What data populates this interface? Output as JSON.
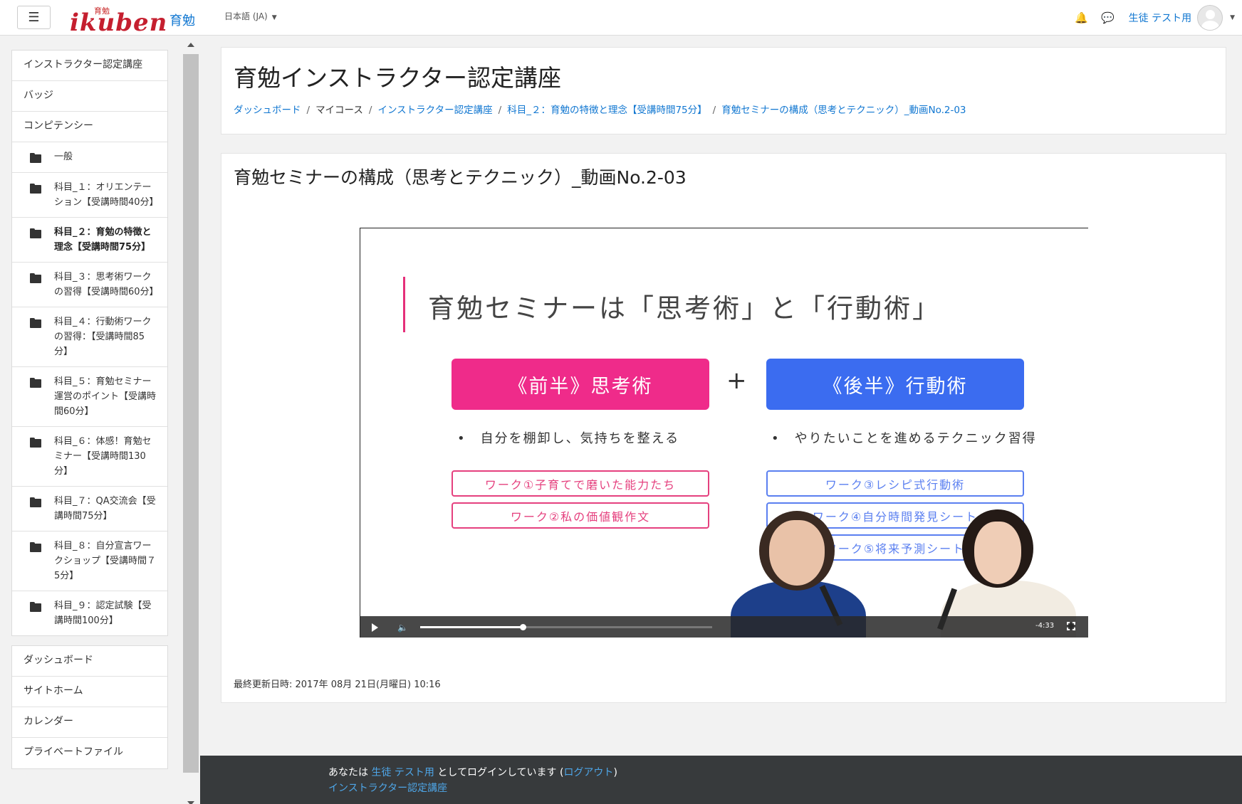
{
  "navbar": {
    "logo_small": "育勉",
    "logo_main": "ikuben",
    "site_name": "育勉",
    "language": "日本語 (JA)",
    "user_name": "生徒 テスト用"
  },
  "sidebar": {
    "top_items": [
      {
        "label": "インストラクター認定講座"
      },
      {
        "label": "バッジ"
      },
      {
        "label": "コンピテンシー"
      }
    ],
    "sections": [
      {
        "label": "一般"
      },
      {
        "label": "科目_１：オリエンテーション【受講時間40分】"
      },
      {
        "label": "科目_２：育勉の特徴と理念【受講時間75分】"
      },
      {
        "label": "科目_３：思考術ワークの習得【受講時間60分】"
      },
      {
        "label": "科目_４：行動術ワークの習得：【受講時間85分】"
      },
      {
        "label": "科目_５：育勉セミナー運営のポイント【受講時間60分】"
      },
      {
        "label": "科目_６：体感！育勉セミナー【受講時間130分】"
      },
      {
        "label": "科目_７：QA交流会【受講時間75分】"
      },
      {
        "label": "科目_８：自分宣言ワークショップ【受講時間７5分】"
      },
      {
        "label": "科目_９：認定試験【受講時間100分】"
      }
    ],
    "nav_items": [
      {
        "label": "ダッシュボード"
      },
      {
        "label": "サイトホーム"
      },
      {
        "label": "カレンダー"
      },
      {
        "label": "プライベートファイル"
      }
    ]
  },
  "header": {
    "title": "育勉インストラクター認定講座",
    "breadcrumb": [
      "ダッシュボード",
      "マイコース",
      "インストラクター認定講座",
      "科目_２：育勉の特徴と理念【受講時間75分】",
      "育勉セミナーの構成（思考とテクニック）_動画No.2-03"
    ]
  },
  "activity": {
    "title": "育勉セミナーの構成（思考とテクニック）_動画No.2-03",
    "last_modified": "最終更新日時: 2017年 08月 21日(月曜日) 10:16"
  },
  "video": {
    "slide_title": "育勉セミナーは「思考術」と「行動術」",
    "left_box": "《前半》思考術",
    "right_box": "《後半》行動術",
    "plus": "+",
    "left_bullet": "•　自分を棚卸し、気持ちを整える",
    "right_bullet": "•　やりたいことを進めるテクニック習得",
    "left_works": [
      "ワーク①子育てで磨いた能力たち",
      "ワーク②私の価値観作文"
    ],
    "right_works": [
      "ワーク③レシピ式行動術",
      "ワーク④自分時間発見シート",
      "ワーク⑤将来予測シート"
    ],
    "time_remaining": "-4:33",
    "progress": 0.35,
    "colors": {
      "pink": "#ef2b8a",
      "blue": "#3b6cf0"
    }
  },
  "footer": {
    "logged_in_prefix": "あなたは",
    "user_link": "生徒 テスト用",
    "logged_in_mid": "としてログインしています (",
    "logout": "ログアウト",
    "logged_in_suffix": ")",
    "course_link": "インストラクター認定講座"
  }
}
